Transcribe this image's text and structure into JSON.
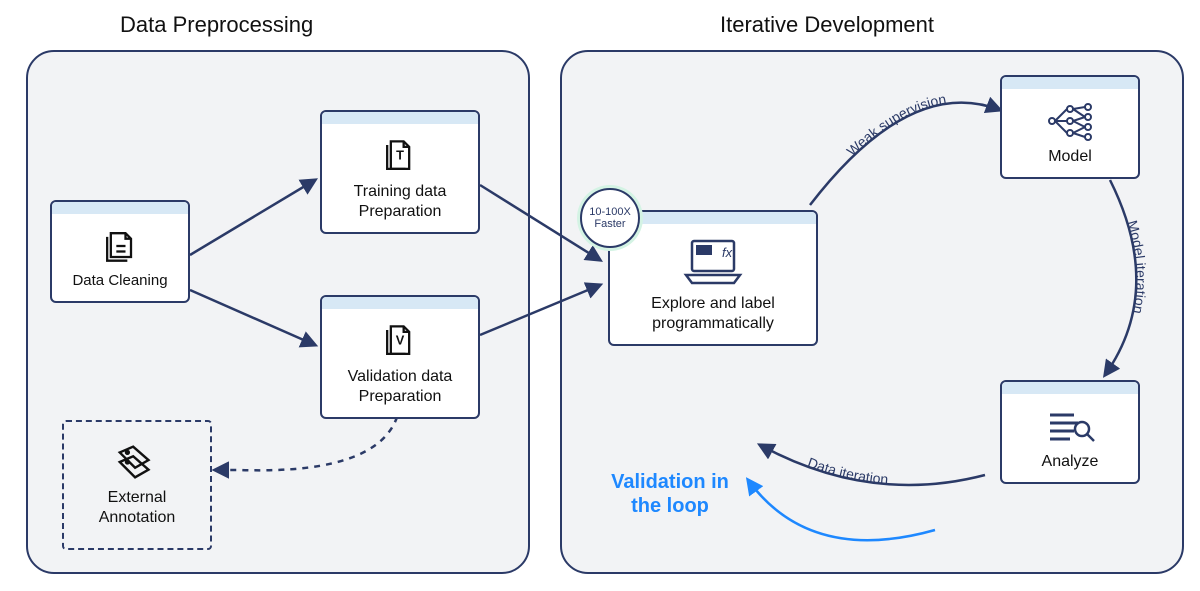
{
  "sections": {
    "preprocessing": {
      "title": "Data Preprocessing"
    },
    "iterative": {
      "title": "Iterative Development"
    }
  },
  "cards": {
    "data_cleaning": {
      "label": "Data Cleaning"
    },
    "training_prep": {
      "label_line1": "Training data",
      "label_line2": "Preparation"
    },
    "validation_prep": {
      "label_line1": "Validation data",
      "label_line2": "Preparation"
    },
    "external_ann": {
      "label_line1": "External",
      "label_line2": "Annotation"
    },
    "explore": {
      "label_line1": "Explore and label",
      "label_line2": "programmatically"
    },
    "model": {
      "label": "Model"
    },
    "analyze": {
      "label": "Analyze"
    }
  },
  "badge": {
    "line1": "10-100X",
    "line2": "Faster"
  },
  "arrows": {
    "weak_supervision": "Weak supervision",
    "model_iteration": "Model iteration",
    "data_iteration": "Data iteration"
  },
  "validation_loop": {
    "line1": "Validation in",
    "line2": "the loop"
  },
  "colors": {
    "primary": "#2b3a67",
    "panel_bg": "#f2f3f5",
    "card_header": "#d7e8f5",
    "accent_blue": "#1e88ff"
  }
}
